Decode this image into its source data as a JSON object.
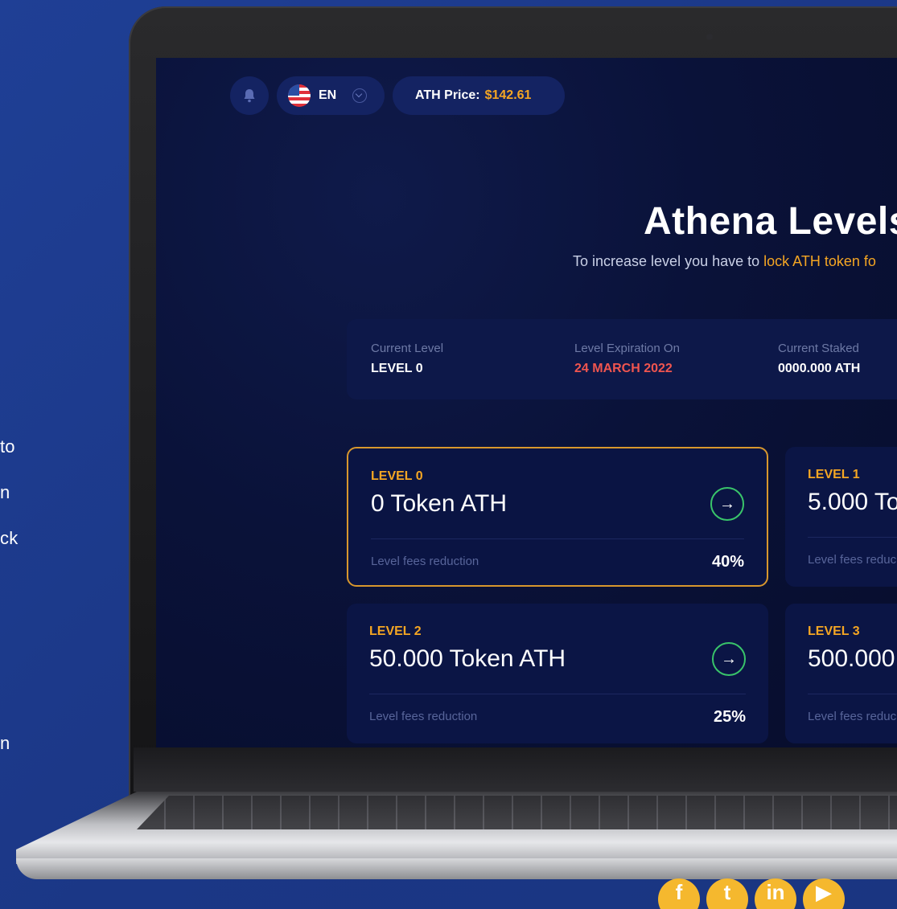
{
  "side_text": [
    "to",
    "n",
    "ck",
    "n"
  ],
  "header": {
    "language": "EN",
    "price_label": "ATH Price:",
    "price_value": "$142.61"
  },
  "hero": {
    "title": "Athena Levels",
    "subtitle_prefix": "To increase level you have to ",
    "subtitle_accent": "lock ATH token fo"
  },
  "status": [
    {
      "label": "Current Level",
      "value": "LEVEL 0"
    },
    {
      "label": "Level Expiration On",
      "value": "24 MARCH 2022"
    },
    {
      "label": "Current Staked",
      "value": "0000.000 ATH"
    }
  ],
  "levels": [
    {
      "tag": "LEVEL 0",
      "amount": "0 Token ATH",
      "fees_label": "Level fees reduction",
      "fees_value": "40%"
    },
    {
      "tag": "LEVEL 1",
      "amount": "5.000 To",
      "fees_label": "Level fees reduc",
      "fees_value": ""
    },
    {
      "tag": "LEVEL 2",
      "amount": "50.000 Token ATH",
      "fees_label": "Level fees reduction",
      "fees_value": "25%"
    },
    {
      "tag": "LEVEL 3",
      "amount": "500.000",
      "fees_label": "Level fees reduc",
      "fees_value": ""
    }
  ],
  "social": [
    "f",
    "t",
    "in",
    "▶"
  ],
  "colors": {
    "background": "#1c3a8c",
    "accent": "#f5a623",
    "expiry_red": "#f0554f",
    "arrow_green": "#39c46a"
  }
}
